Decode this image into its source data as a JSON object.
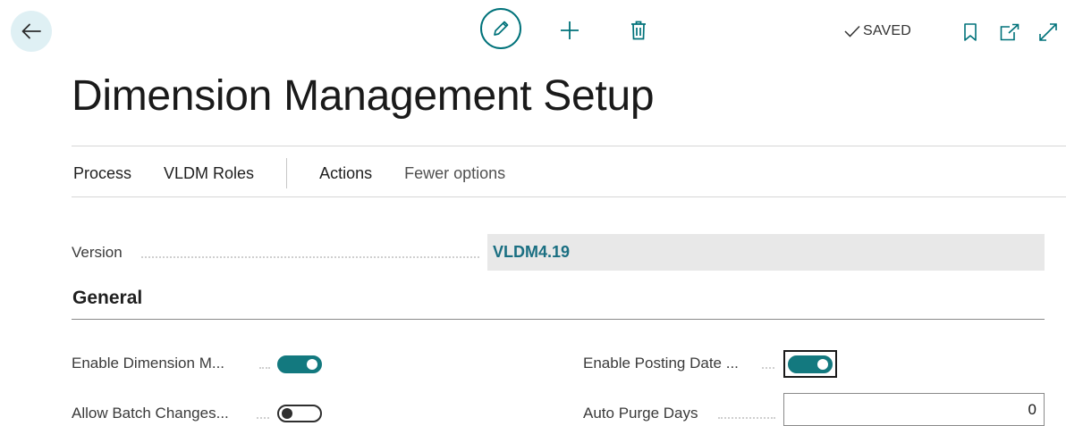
{
  "toolbar": {
    "back_icon": "arrow-left-icon",
    "edit_icon": "pencil-icon",
    "add_icon": "plus-icon",
    "delete_icon": "trash-icon",
    "saved_label": "SAVED",
    "saved_icon": "checkmark-icon",
    "bookmark_icon": "bookmark-icon",
    "popout_icon": "open-new-window-icon",
    "expand_icon": "expand-icon"
  },
  "page": {
    "title": "Dimension Management Setup"
  },
  "nav": {
    "items": [
      {
        "label": "Process"
      },
      {
        "label": "VLDM Roles"
      },
      {
        "label": "Actions"
      },
      {
        "label": "Fewer options"
      }
    ]
  },
  "fields": {
    "version": {
      "label": "Version",
      "value": "VLDM4.19"
    }
  },
  "general": {
    "title": "General",
    "enable_dimension": {
      "label": "Enable Dimension M...",
      "state": "on"
    },
    "allow_batch": {
      "label": "Allow Batch Changes...",
      "state": "off"
    },
    "enable_posting_date": {
      "label": "Enable Posting Date ...",
      "state": "on"
    },
    "auto_purge_days": {
      "label": "Auto Purge Days",
      "value": "0"
    }
  },
  "colors": {
    "accent": "#13797f",
    "version_text": "#1a6f82",
    "back_bg": "#dff0f4"
  }
}
